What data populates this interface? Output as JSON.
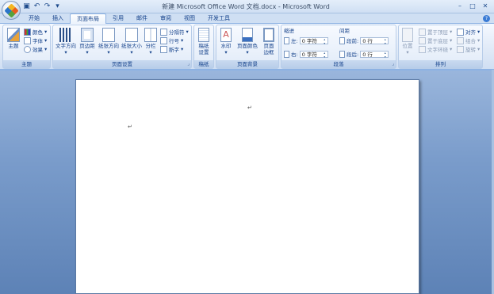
{
  "window": {
    "title": "新建 Microsoft Office Word 文档.docx - Microsoft Word",
    "controls": {
      "minimize": "–",
      "maximize": "□",
      "close": "✕"
    }
  },
  "quick_access": [
    {
      "name": "save-icon",
      "glyph": "▣"
    },
    {
      "name": "undo-icon",
      "glyph": "↶"
    },
    {
      "name": "redo-icon",
      "glyph": "↷"
    },
    {
      "name": "customize-icon",
      "glyph": "▾"
    }
  ],
  "tabs": [
    "开始",
    "插入",
    "页面布局",
    "引用",
    "邮件",
    "审阅",
    "视图",
    "开发工具"
  ],
  "active_tab": "页面布局",
  "help_glyph": "?",
  "ribbon": {
    "theme": {
      "title": "主题",
      "big": {
        "label": "主题",
        "icon": "themes-icon"
      },
      "items": [
        {
          "label": "颜色",
          "icon": "colors-icon"
        },
        {
          "label": "字体",
          "icon": "fonts-icon"
        },
        {
          "label": "效果",
          "icon": "effects-icon"
        }
      ]
    },
    "page_setup": {
      "title": "页面设置",
      "buttons": [
        {
          "label": "文字方向",
          "icon": "text-direction-icon"
        },
        {
          "label": "页边距",
          "icon": "margins-icon"
        },
        {
          "label": "纸张方向",
          "icon": "orientation-icon"
        },
        {
          "label": "纸张大小",
          "icon": "size-icon"
        },
        {
          "label": "分栏",
          "icon": "columns-icon"
        }
      ],
      "items": [
        {
          "label": "分隔符",
          "icon": "breaks-icon"
        },
        {
          "label": "行号",
          "icon": "line-numbers-icon"
        },
        {
          "label": "断字",
          "icon": "hyphenation-icon"
        }
      ]
    },
    "draft": {
      "title": "稿纸",
      "button": "稿纸\n设置",
      "icon": "draft-paper-icon"
    },
    "background": {
      "title": "页面背景",
      "buttons": [
        {
          "label": "水印",
          "icon": "watermark-icon"
        },
        {
          "label": "页面颜色",
          "icon": "page-color-icon"
        },
        {
          "label": "页面\n边框",
          "icon": "page-borders-icon"
        }
      ]
    },
    "paragraph": {
      "title": "段落",
      "indent_label": "缩进",
      "spacing_label": "间距",
      "left_label": "左:",
      "left_value": "0 字符",
      "right_label": "右:",
      "right_value": "0 字符",
      "before_label": "段前:",
      "before_value": "0 行",
      "after_label": "段后:",
      "after_value": "0 行"
    },
    "arrange": {
      "title": "排列",
      "position": {
        "label": "位置",
        "icon": "position-icon"
      },
      "items": [
        {
          "label": "置于顶层",
          "icon": "bring-front-icon"
        },
        {
          "label": "置于底层",
          "icon": "send-back-icon"
        },
        {
          "label": "文字环绕",
          "icon": "text-wrap-icon"
        }
      ],
      "items2": [
        {
          "label": "对齐",
          "icon": "align-icon"
        },
        {
          "label": "组合",
          "icon": "group-icon"
        },
        {
          "label": "旋转",
          "icon": "rotate-icon"
        }
      ]
    }
  },
  "document": {
    "para_marks": [
      "↵",
      "↵"
    ]
  }
}
